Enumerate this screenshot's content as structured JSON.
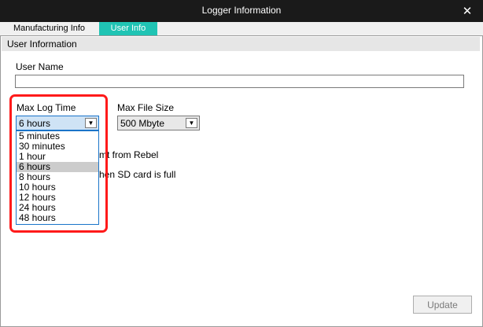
{
  "window": {
    "title": "Logger Information",
    "close_glyph": "✕"
  },
  "tabs": [
    {
      "label": "Manufacturing Info",
      "active": false
    },
    {
      "label": "User Info",
      "active": true
    }
  ],
  "section": {
    "title": "User Information"
  },
  "user_name": {
    "label": "User Name",
    "value": ""
  },
  "max_log_time": {
    "label": "Max Log Time",
    "selected": "6 hours",
    "options": [
      "5 minutes",
      "30 minutes",
      "1 hour",
      "6 hours",
      "8 hours",
      "10 hours",
      "12 hours",
      "24 hours",
      "48 hours"
    ],
    "selected_index": 3
  },
  "max_file_size": {
    "label": "Max File Size",
    "selected": "500 Mbyte"
  },
  "partially_hidden": {
    "option1_tail": "mt from Rebel",
    "option2_tail": "hen SD card is full"
  },
  "buttons": {
    "update": "Update"
  },
  "colors": {
    "active_tab": "#20c4b4",
    "titlebar": "#1a1a1a",
    "highlight": "#ff1a1a",
    "focus": "#1a74c9"
  }
}
